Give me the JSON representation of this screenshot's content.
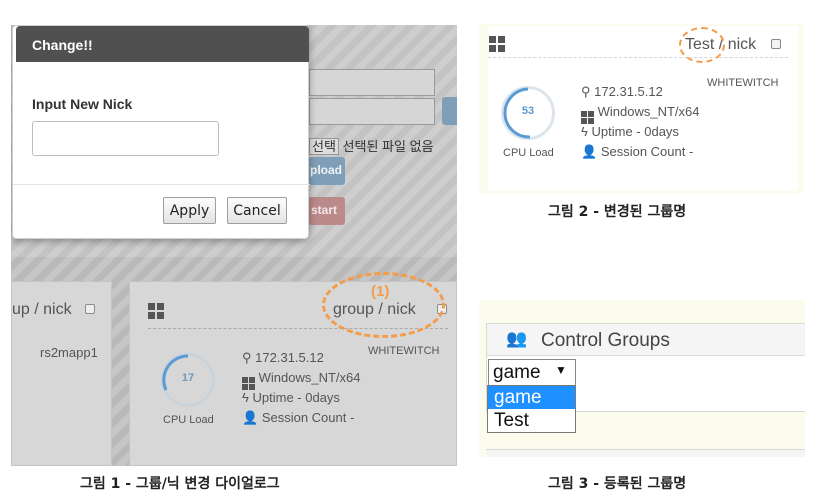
{
  "figure1": {
    "background": {
      "file_choose_button": "선택",
      "file_no_selection": "선택된 파일 없음",
      "upload_label": "pload",
      "start_label": "start"
    },
    "dialog": {
      "title": "Change!!",
      "input_label": "Input New Nick",
      "input_value": "",
      "apply_label": "Apply",
      "cancel_label": "Cancel"
    },
    "left_card": {
      "title": "up / nick",
      "host": "rs2mapp1"
    },
    "card": {
      "group": "group",
      "separator": " / ",
      "nick": "nick",
      "annotation": "(1)",
      "machine": "WHITEWITCH",
      "ip": "172.31.5.12",
      "os": "Windows_NT/x64",
      "uptime": "Uptime - 0days",
      "sessions": "Session Count -",
      "cpu_value": "17",
      "cpu_label": "CPU Load"
    },
    "caption": "그림 1 - 그룹/닉 변경 다이얼로그"
  },
  "figure2": {
    "card": {
      "group": "Test",
      "separator": " / ",
      "nick": "nick",
      "machine": "WHITEWITCH",
      "ip": "172.31.5.12",
      "os": "Windows_NT/x64",
      "uptime": "Uptime - 0days",
      "sessions": "Session Count -",
      "cpu_value": "53",
      "cpu_label": "CPU Load"
    },
    "caption": "그림 2 - 변경된 그룹명"
  },
  "figure3": {
    "panel_title": "Control Groups",
    "selected": "game",
    "options": [
      "game",
      "Test"
    ],
    "caption": "그림 3 - 등록된 그룹명"
  },
  "colors": {
    "annotation_orange": "#f39c4a",
    "gauge_blue": "#5b9bd5",
    "option_highlight": "#1e90ff",
    "dialog_header": "#505050"
  },
  "icons": [
    "windows-icon",
    "map-marker-icon",
    "bolt-icon",
    "user-icon",
    "users-icon",
    "caret-down-icon"
  ]
}
